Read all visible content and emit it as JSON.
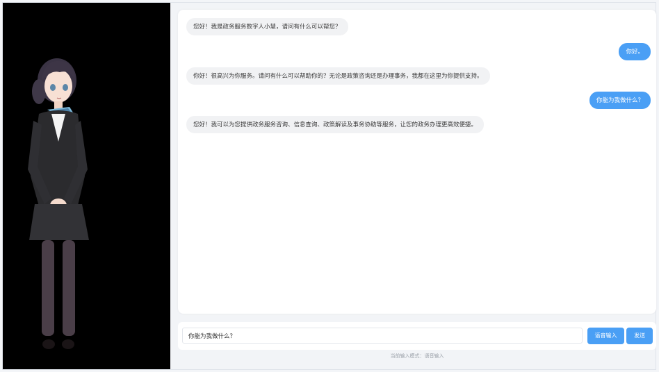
{
  "avatar": {
    "alt": "digital human avatar"
  },
  "messages": [
    {
      "role": "bot",
      "text": "您好！我是政务服务数字人小慧，请问有什么可以帮您？"
    },
    {
      "role": "user",
      "text": "你好。"
    },
    {
      "role": "bot",
      "text": "你好！很高兴为你服务。请问有什么可以帮助你的？无论是政策咨询还是办理事务，我都在这里为你提供支持。"
    },
    {
      "role": "user",
      "text": "你能为我做什么？"
    },
    {
      "role": "bot",
      "text": "您好！我可以为您提供政务服务咨询、信息查询、政策解读及事务协助等服务，让您的政务办理更高效便捷。"
    }
  ],
  "input": {
    "value": "你能为我做什么？",
    "placeholder": ""
  },
  "buttons": {
    "voice_label": "语音输入",
    "send_label": "发送"
  },
  "mode_label": "当前输入模式：语音输入",
  "colors": {
    "accent": "#4a9ff5",
    "bot_bubble": "#f1f2f4",
    "avatar_bg": "#000000"
  }
}
